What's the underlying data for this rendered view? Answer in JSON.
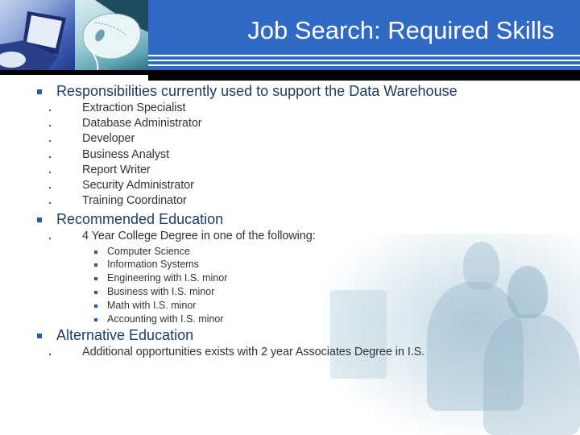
{
  "header": {
    "title": "Job Search: Required Skills",
    "colors": {
      "band": "#316ac5",
      "stripes": "#ffffff",
      "bar": "#000000"
    },
    "images": [
      "laptop-photo",
      "computer-mouse-photo"
    ]
  },
  "sections": [
    {
      "heading": "Responsibilities currently used to support the Data Warehouse",
      "items": [
        "Extraction Specialist",
        "Database Administrator",
        "Developer",
        "Business Analyst",
        "Report Writer",
        "Security Administrator",
        "Training Coordinator"
      ]
    },
    {
      "heading": "Recommended Education",
      "items": [
        {
          "text": "4 Year College Degree in one of the following:",
          "subitems": [
            "Computer Science",
            "Information Systems",
            "Engineering with I.S. minor",
            "Business with I.S. minor",
            "Math with I.S. minor",
            "Accounting with I.S. minor"
          ]
        }
      ]
    },
    {
      "heading": "Alternative Education",
      "items": [
        "Additional opportunities exists with 2 year Associates Degree in I.S."
      ]
    }
  ],
  "colors": {
    "heading_text": "#1f3c64",
    "body_text": "#333333",
    "bullet": "#2b58a5"
  }
}
